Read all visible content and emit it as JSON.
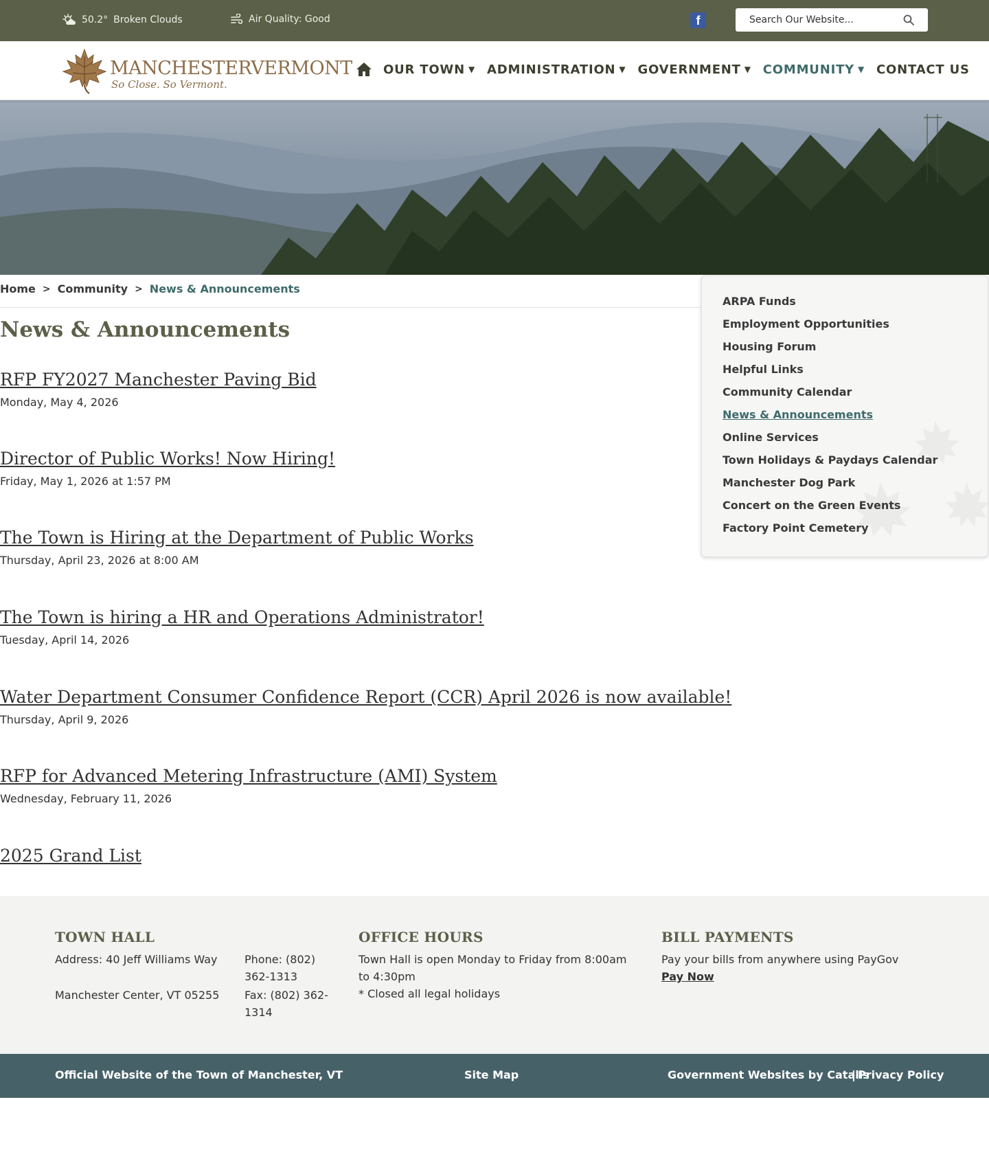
{
  "topbar": {
    "temperature": "50.2°",
    "conditions": "Broken Clouds",
    "air_quality": "Air Quality: Good",
    "facebook_glyph": "f",
    "search_placeholder": "Search Our Website..."
  },
  "logo": {
    "name": "MANCHESTERVERMONT",
    "tagline": "So Close. So Vermont."
  },
  "nav": {
    "items": [
      {
        "label": "OUR TOWN",
        "caret": "▼"
      },
      {
        "label": "ADMINISTRATION",
        "caret": "▼"
      },
      {
        "label": "GOVERNMENT",
        "caret": "▼"
      },
      {
        "label": "COMMUNITY",
        "caret": "▼"
      },
      {
        "label": "CONTACT US"
      }
    ]
  },
  "breadcrumb": {
    "home": "Home",
    "sep": ">",
    "parent": "Community",
    "current": "News & Announcements"
  },
  "page": {
    "title": "News & Announcements"
  },
  "news": [
    {
      "title": "RFP FY2027 Manchester Paving Bid",
      "date": "Monday, May 4, 2026"
    },
    {
      "title": "Director of Public Works! Now Hiring!",
      "date": "Friday, May 1, 2026 at 1:57 PM"
    },
    {
      "title": "The Town is Hiring at the Department of Public Works",
      "date": "Thursday, April 23, 2026 at 8:00 AM"
    },
    {
      "title": "The Town is hiring a HR and Operations Administrator!",
      "date": "Tuesday, April 14, 2026"
    },
    {
      "title": "Water Department Consumer Confidence Report (CCR) April 2026 is now available!",
      "date": "Thursday, April 9, 2026"
    },
    {
      "title": "RFP for Advanced Metering Infrastructure (AMI) System",
      "date": "Wednesday, February 11, 2026"
    },
    {
      "title": "2025 Grand List",
      "date": ""
    }
  ],
  "sidebar": {
    "items": [
      "ARPA Funds",
      "Employment Opportunities",
      "Housing Forum",
      "Helpful Links",
      "Community Calendar",
      "News & Announcements",
      "Online Services",
      "Town Holidays & Paydays Calendar",
      "Manchester Dog Park",
      "Concert on the Green Events",
      "Factory Point Cemetery"
    ]
  },
  "footer": {
    "town_hall": {
      "heading": "TOWN HALL",
      "address": "Address: 40 Jeff Williams Way",
      "phone": "Phone: (802) 362-1313",
      "city": "Manchester Center, VT 05255",
      "fax": "Fax: (802) 362-1314"
    },
    "office_hours": {
      "heading": "OFFICE HOURS",
      "text": "Town Hall is open Monday to Friday from 8:00am to 4:30pm",
      "note": "* Closed all legal holidays"
    },
    "bill_payments": {
      "heading": "BILL PAYMENTS",
      "text": "Pay your bills from anywhere using PayGov",
      "link": "Pay Now"
    }
  },
  "bottom": {
    "official": "Official Website of the Town of Manchester, VT",
    "sitemap": "Site Map",
    "credit": "Government Websites by Catalis",
    "divider": "|",
    "privacy": "Privacy Policy"
  },
  "colors": {
    "topbar": "#5b6049",
    "accent": "#3f6a6b",
    "footer_bar": "#476168",
    "logo": "#8d6e4a"
  }
}
